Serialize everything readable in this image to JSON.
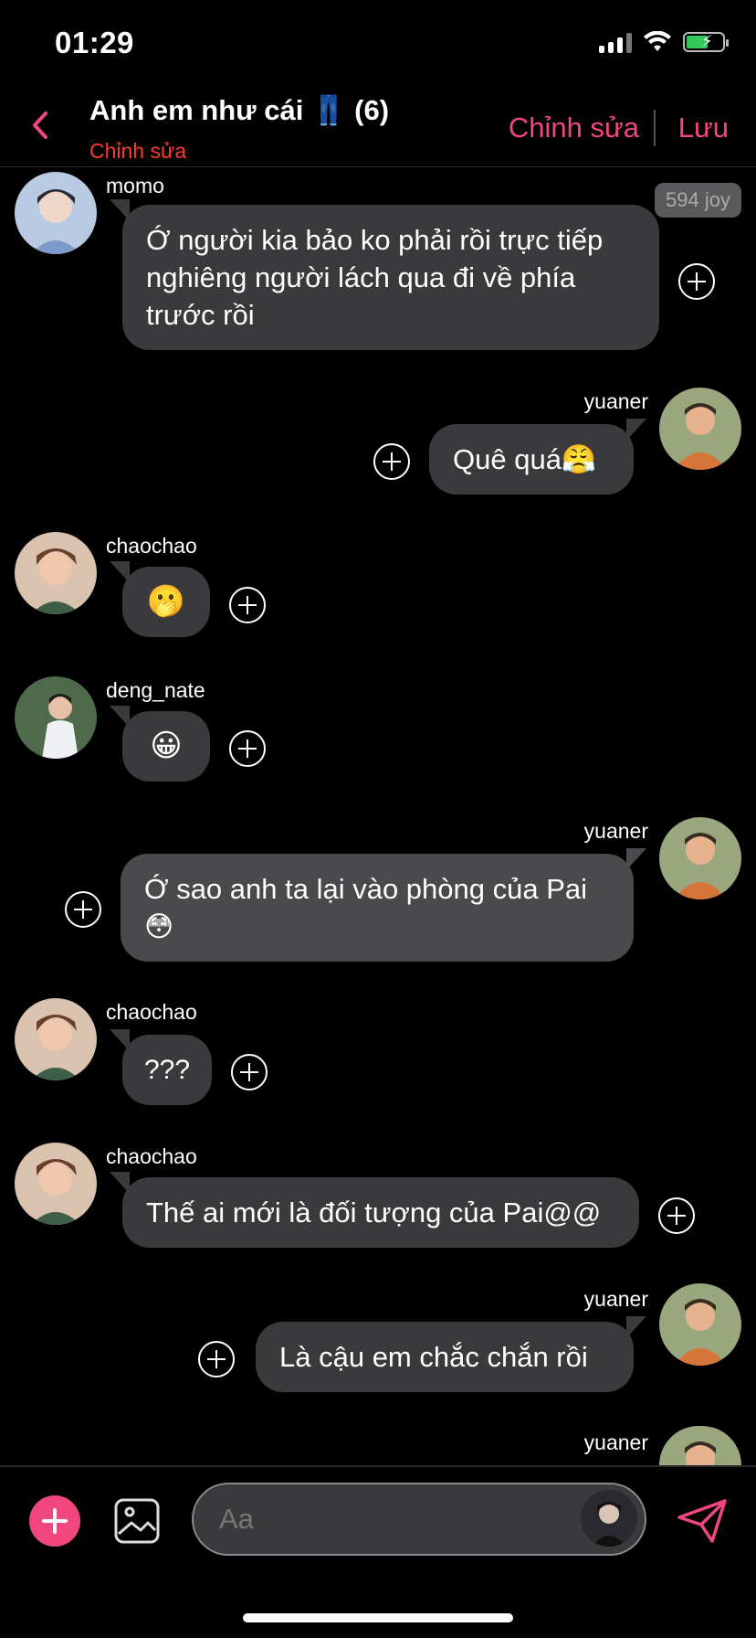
{
  "status": {
    "time": "01:29"
  },
  "header": {
    "title": "Anh em như cái 👖 (6)",
    "subtitle": "Chỉnh sửa",
    "edit_label": "Chỉnh sửa",
    "save_label": "Lưu"
  },
  "badge": "594 joy",
  "messages": [
    {
      "sender": "momo",
      "text": "Ớ người kia bảo ko phải rồi trực tiếp nghiêng người lách qua đi về phía trước rồi"
    },
    {
      "sender": "yuaner",
      "text": "Quê quá😤"
    },
    {
      "sender": "chaochao",
      "text": "🫢"
    },
    {
      "sender": "deng_nate",
      "text": "😀"
    },
    {
      "sender": "yuaner",
      "text": "Ớ sao anh ta lại vào phòng của Pai😳"
    },
    {
      "sender": "chaochao",
      "text": "???"
    },
    {
      "sender": "chaochao",
      "text": "Thế ai mới là đối tượng của Pai@@"
    },
    {
      "sender": "yuaner",
      "text": "Là cậu em chắc chắn rồi"
    },
    {
      "sender": "yuaner",
      "text": ""
    }
  ],
  "input": {
    "placeholder": "Aa"
  },
  "icons": [
    "back-chevron-icon",
    "add-icon",
    "image-icon",
    "send-icon",
    "plus-circle-icon"
  ],
  "colors": {
    "accent": "#f0487e",
    "subtitle": "#ff3b30",
    "bubble": "#3a3a3c"
  }
}
